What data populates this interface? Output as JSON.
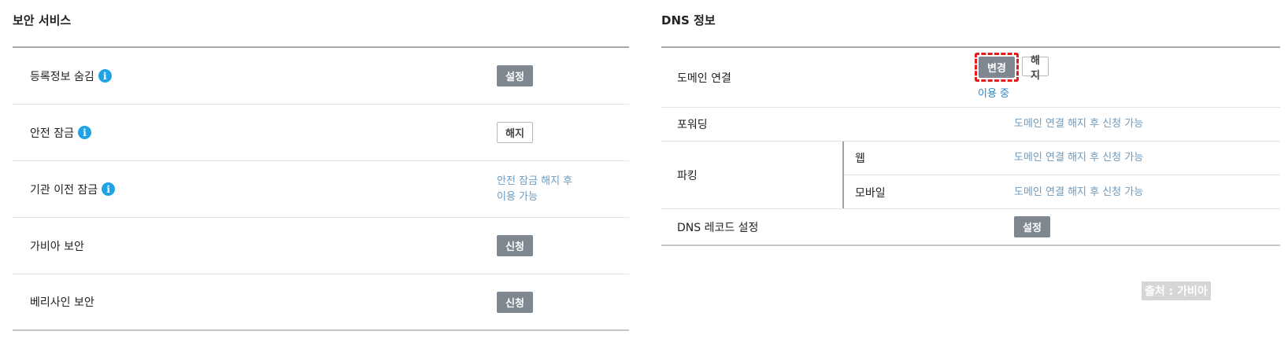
{
  "security": {
    "title": "보안 서비스",
    "rows": [
      {
        "label": "등록정보 숨김",
        "action": "설정"
      },
      {
        "label": "안전 잠금",
        "action": "해지"
      },
      {
        "label": "기관 이전 잠금",
        "note_line1": "안전 잠금 해지 후",
        "note_line2": "이용 가능"
      },
      {
        "label": "가비아 보안",
        "action": "신청"
      },
      {
        "label": "베리사인 보안",
        "action": "신청"
      }
    ]
  },
  "dns": {
    "title": "DNS 정보",
    "domain_connect": {
      "label": "도메인 연결",
      "change_button": "변경",
      "cancel_button": "해지",
      "status": "이용 중"
    },
    "forwarding": {
      "label": "포워딩",
      "value": "도메인 연결 해지 후 신청 가능"
    },
    "parking": {
      "label": "파킹",
      "web": {
        "label": "웹",
        "value": "도메인 연결 해지 후 신청 가능"
      },
      "mobile": {
        "label": "모바일",
        "value": "도메인 연결 해지 후 신청 가능"
      }
    },
    "dns_record": {
      "label": "DNS 레코드 설정",
      "action": "설정"
    }
  },
  "source_caption": "출처 : 가비아",
  "colors": {
    "button_gray": "#7f8790",
    "info_icon": "#1fa2e6",
    "highlight": "#e21b1b",
    "note_text": "#6e9bbf",
    "status_link": "#2f86c5"
  }
}
